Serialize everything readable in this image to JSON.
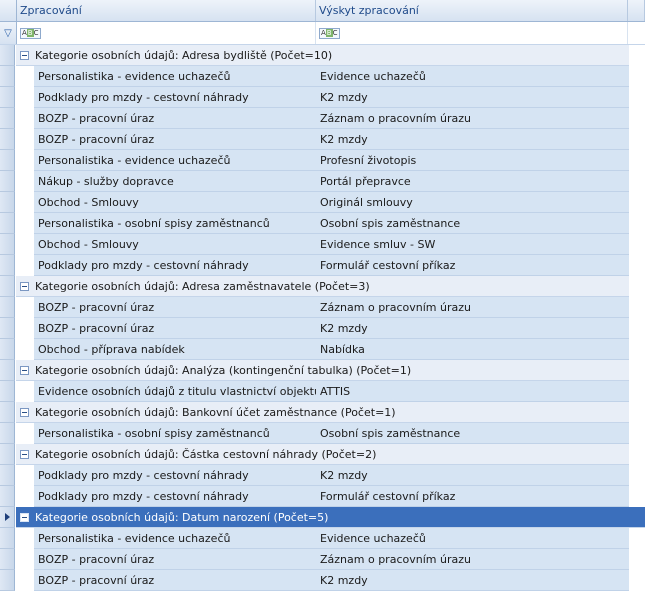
{
  "columns": {
    "col1": "Zpracování",
    "col2": "Výskyt zpracování"
  },
  "filter": {
    "icon1": "ABC",
    "icon2": "ABC",
    "filter_icon": "funnel-icon"
  },
  "groups": [
    {
      "label": "Kategorie osobních údajů: Adresa bydliště (Počet=10)",
      "selected": false,
      "rows": [
        [
          "Personalistika - evidence uchazečů",
          "Evidence uchazečů"
        ],
        [
          "Podklady pro mzdy - cestovní náhrady",
          "K2 mzdy"
        ],
        [
          "BOZP - pracovní úraz",
          "Záznam o pracovním úrazu"
        ],
        [
          "BOZP - pracovní úraz",
          "K2 mzdy"
        ],
        [
          "Personalistika - evidence uchazečů",
          "Profesní životopis"
        ],
        [
          "Nákup - služby dopravce",
          "Portál přepravce"
        ],
        [
          "Obchod - Smlouvy",
          "Originál smlouvy"
        ],
        [
          "Personalistika - osobní spisy zaměstnanců",
          "Osobní spis zaměstnance"
        ],
        [
          "Obchod - Smlouvy",
          "Evidence smluv - SW"
        ],
        [
          "Podklady pro mzdy - cestovní náhrady",
          "Formulář cestovní příkaz"
        ]
      ]
    },
    {
      "label": "Kategorie osobních údajů: Adresa zaměstnavatele (Počet=3)",
      "selected": false,
      "rows": [
        [
          "BOZP - pracovní úraz",
          "Záznam o pracovním úrazu"
        ],
        [
          "BOZP - pracovní úraz",
          "K2 mzdy"
        ],
        [
          "Obchod - příprava nabídek",
          "Nabídka"
        ]
      ]
    },
    {
      "label": "Kategorie osobních údajů: Analýza (kontingenční tabulka) (Počet=1)",
      "selected": false,
      "rows": [
        [
          "Evidence osobních údajů z titulu vlastnictví objektu",
          "ATTIS"
        ]
      ]
    },
    {
      "label": "Kategorie osobních údajů: Bankovní účet zaměstnance (Počet=1)",
      "selected": false,
      "rows": [
        [
          "Personalistika - osobní spisy zaměstnanců",
          "Osobní spis zaměstnance"
        ]
      ]
    },
    {
      "label": "Kategorie osobních údajů: Částka cestovní náhrady (Počet=2)",
      "selected": false,
      "rows": [
        [
          "Podklady pro mzdy - cestovní náhrady",
          "K2 mzdy"
        ],
        [
          "Podklady pro mzdy - cestovní náhrady",
          "Formulář cestovní příkaz"
        ]
      ]
    },
    {
      "label": "Kategorie osobních údajů: Datum narození (Počet=5)",
      "selected": true,
      "rows": [
        [
          "Personalistika - evidence uchazečů",
          "Evidence uchazečů"
        ],
        [
          "BOZP - pracovní úraz",
          "Záznam o pracovním úrazu"
        ],
        [
          "BOZP - pracovní úraz",
          "K2 mzdy"
        ]
      ]
    }
  ]
}
